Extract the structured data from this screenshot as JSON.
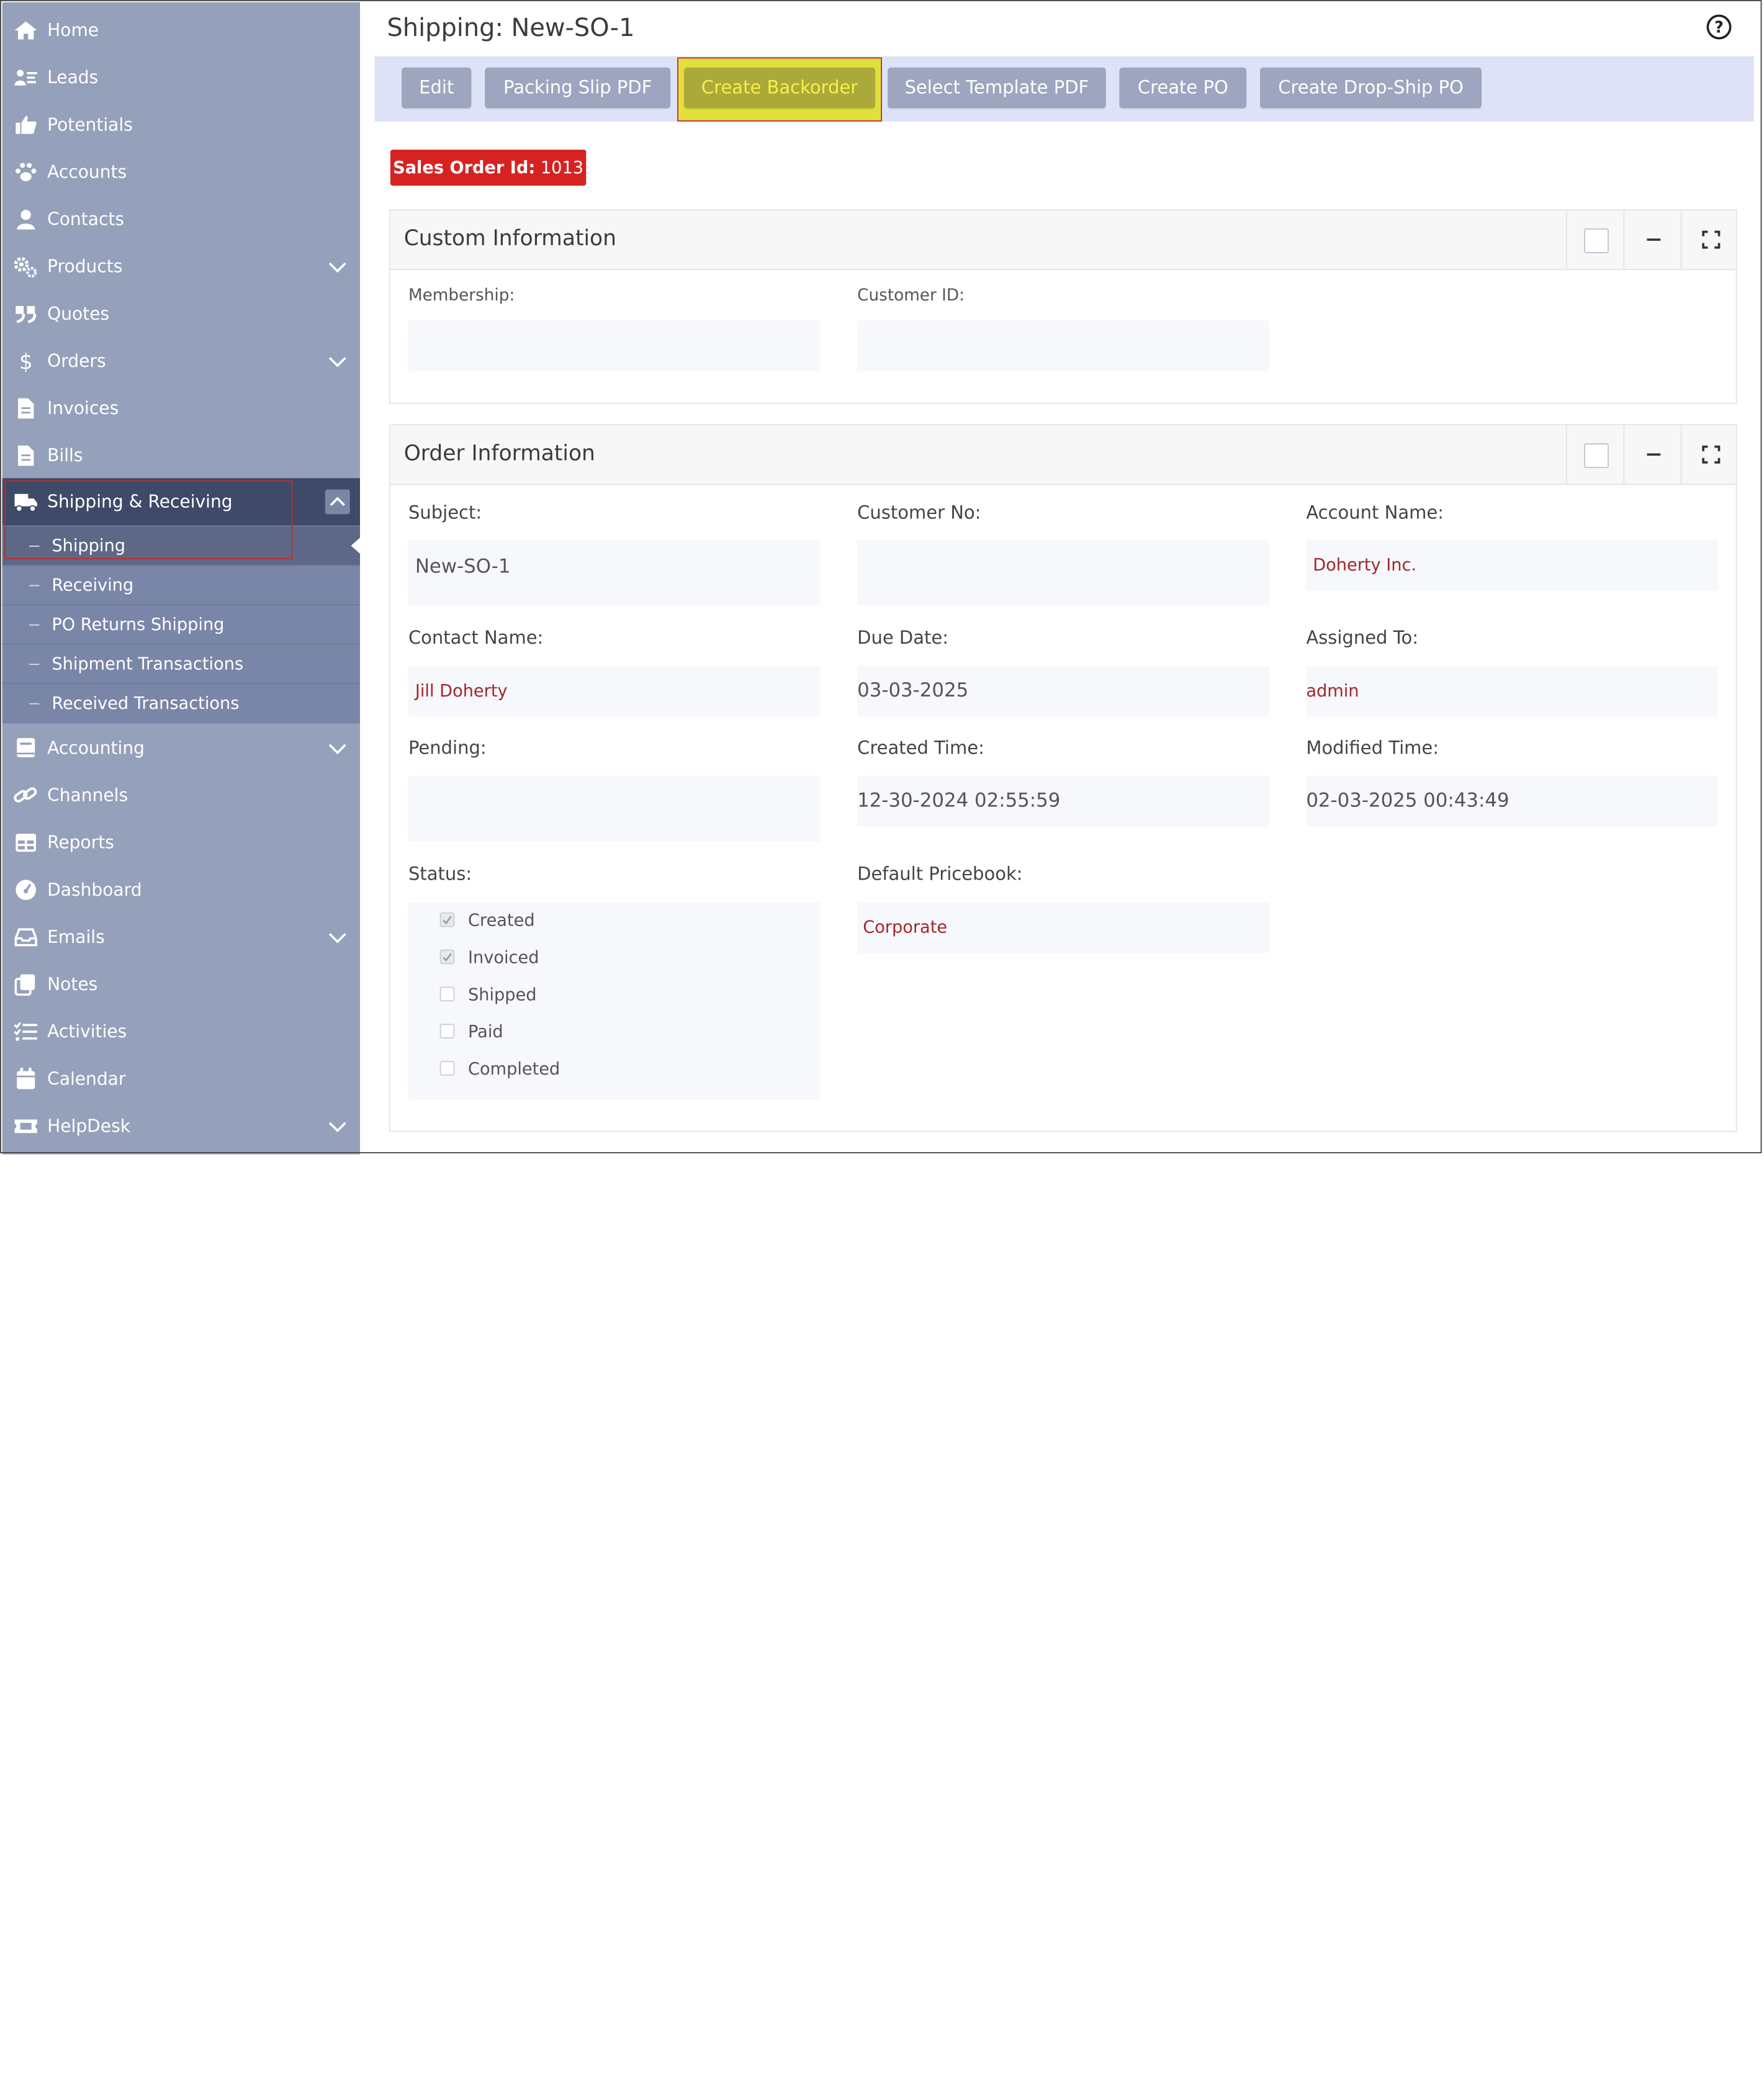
{
  "sidebar": {
    "items": [
      {
        "label": "Home",
        "icon": "home-icon"
      },
      {
        "label": "Leads",
        "icon": "leads-icon"
      },
      {
        "label": "Potentials",
        "icon": "thumbs-up-icon"
      },
      {
        "label": "Accounts",
        "icon": "paw-icon"
      },
      {
        "label": "Contacts",
        "icon": "user-icon"
      },
      {
        "label": "Products",
        "icon": "gears-icon"
      },
      {
        "label": "Quotes",
        "icon": "quote-icon"
      },
      {
        "label": "Orders",
        "icon": "dollar-icon"
      },
      {
        "label": "Invoices",
        "icon": "file-icon"
      },
      {
        "label": "Bills",
        "icon": "file-icon"
      },
      {
        "label": "Shipping & Receiving",
        "icon": "truck-icon"
      },
      {
        "label": "Accounting",
        "icon": "book-icon"
      },
      {
        "label": "Channels",
        "icon": "link-icon"
      },
      {
        "label": "Reports",
        "icon": "table-icon"
      },
      {
        "label": "Dashboard",
        "icon": "gauge-icon"
      },
      {
        "label": "Emails",
        "icon": "inbox-icon"
      },
      {
        "label": "Notes",
        "icon": "notes-icon"
      },
      {
        "label": "Activities",
        "icon": "checklist-icon"
      },
      {
        "label": "Calendar",
        "icon": "calendar-icon"
      },
      {
        "label": "HelpDesk",
        "icon": "ticket-icon"
      }
    ],
    "submenu": [
      {
        "label": "Shipping"
      },
      {
        "label": "Receiving"
      },
      {
        "label": "PO Returns Shipping"
      },
      {
        "label": "Shipment Transactions"
      },
      {
        "label": "Received Transactions"
      }
    ]
  },
  "header": {
    "title": "Shipping: New-SO-1",
    "help_icon": "help-circle-icon"
  },
  "toolbar": {
    "edit": "Edit",
    "packing_slip": "Packing Slip PDF",
    "create_backorder": "Create Backorder",
    "select_template": "Select Template PDF",
    "create_po": "Create PO",
    "create_dropship": "Create Drop-Ship PO"
  },
  "badge": {
    "label": "Sales Order Id:",
    "value": "1013",
    "color": "#d72222"
  },
  "custom_info": {
    "title": "Custom Information",
    "membership_label": "Membership:",
    "membership_value": "",
    "customer_id_label": "Customer ID:",
    "customer_id_value": ""
  },
  "order_info": {
    "title": "Order Information",
    "subject_label": "Subject:",
    "subject_value": "New-SO-1",
    "customer_no_label": "Customer No:",
    "customer_no_value": "",
    "account_name_label": "Account Name:",
    "account_name_value": "Doherty Inc.",
    "contact_name_label": "Contact Name:",
    "contact_name_value": "Jill Doherty",
    "due_date_label": "Due Date:",
    "due_date_value": "03-03-2025",
    "assigned_to_label": "Assigned To:",
    "assigned_to_value": "admin",
    "pending_label": "Pending:",
    "pending_value": "",
    "created_time_label": "Created Time:",
    "created_time_value": "12-30-2024 02:55:59",
    "modified_time_label": "Modified Time:",
    "modified_time_value": "02-03-2025 00:43:49",
    "status_label": "Status:",
    "status_options": [
      {
        "label": "Created",
        "checked": true
      },
      {
        "label": "Invoiced",
        "checked": true
      },
      {
        "label": "Shipped",
        "checked": false
      },
      {
        "label": "Paid",
        "checked": false
      },
      {
        "label": "Completed",
        "checked": false
      }
    ],
    "pricebook_label": "Default Pricebook:",
    "pricebook_value": "Corporate"
  },
  "colors": {
    "sidebar_bg": "#95a0ba",
    "sidebar_active": "#3f4a68",
    "link_red": "#a5262a",
    "backorder_yellow": "#e0df3c",
    "toolbar_bg": "#dde2f7"
  }
}
